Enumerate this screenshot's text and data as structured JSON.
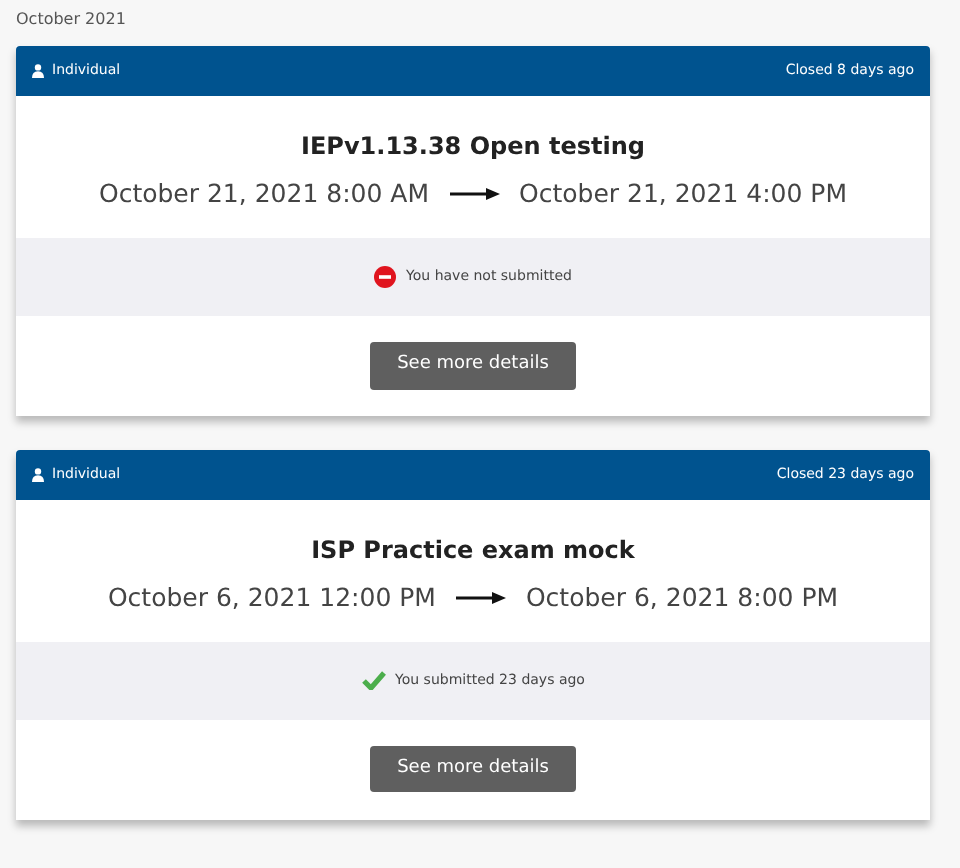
{
  "month_heading": "October 2021",
  "cards": [
    {
      "type": "Individual",
      "closed": "Closed 8 days ago",
      "title": "IEPv1.13.38 Open testing",
      "start": "October 21, 2021 8:00 AM",
      "end": "October 21, 2021 4:00 PM",
      "submitted": false,
      "status": "You have not submitted",
      "button": "See more details"
    },
    {
      "type": "Individual",
      "closed": "Closed 23 days ago",
      "title": "ISP Practice exam mock",
      "start": "October 6, 2021 12:00 PM",
      "end": "October 6, 2021 8:00 PM",
      "submitted": true,
      "status": "You submitted 23 days ago",
      "button": "See more details"
    }
  ]
}
